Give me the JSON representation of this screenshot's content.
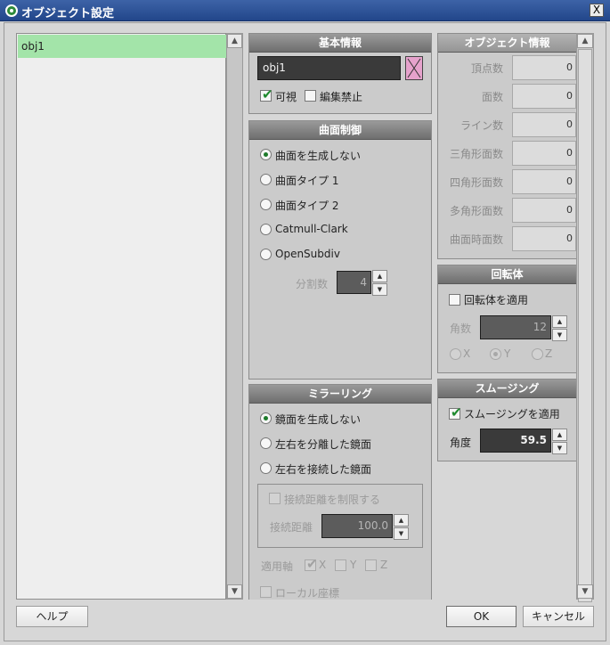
{
  "window": {
    "title": "オブジェクト設定",
    "close_glyph": "X"
  },
  "object_list": {
    "items": [
      "obj1"
    ]
  },
  "basic_info": {
    "title": "基本情報",
    "name_value": "obj1",
    "visible_label": "可視",
    "visible_checked": true,
    "lock_edit_label": "編集禁止",
    "lock_edit_checked": false
  },
  "subdivision": {
    "title": "曲面制御",
    "options": [
      "曲面を生成しない",
      "曲面タイプ 1",
      "曲面タイプ 2",
      "Catmull-Clark",
      "OpenSubdiv"
    ],
    "selected_index": 0,
    "divisions_label": "分割数",
    "divisions_value": "4"
  },
  "mirroring": {
    "title": "ミラーリング",
    "options": [
      "鏡面を生成しない",
      "左右を分離した鏡面",
      "左右を接続した鏡面"
    ],
    "selected_index": 0,
    "limit_distance_label": "接続距離を制限する",
    "distance_label": "接続距離",
    "distance_value": "100.0",
    "axis_label": "適用軸",
    "axis_x": "X",
    "axis_y": "Y",
    "axis_z": "Z",
    "local_coords_label": "ローカル座標"
  },
  "object_info": {
    "title": "オブジェクト情報",
    "rows": [
      {
        "label": "頂点数",
        "value": "0"
      },
      {
        "label": "面数",
        "value": "0"
      },
      {
        "label": "ライン数",
        "value": "0"
      },
      {
        "label": "三角形面数",
        "value": "0"
      },
      {
        "label": "四角形面数",
        "value": "0"
      },
      {
        "label": "多角形面数",
        "value": "0"
      },
      {
        "label": "曲面時面数",
        "value": "0"
      }
    ]
  },
  "lathe": {
    "title": "回転体",
    "apply_label": "回転体を適用",
    "angle_label": "角数",
    "angle_value": "12",
    "axis_x": "X",
    "axis_y": "Y",
    "axis_z": "Z"
  },
  "smoothing": {
    "title": "スムージング",
    "apply_label": "スムージングを適用",
    "apply_checked": true,
    "angle_label": "角度",
    "angle_value": "59.5"
  },
  "buttons": {
    "help": "ヘルプ",
    "ok": "OK",
    "cancel": "キャンセル"
  },
  "icons": {
    "check": "✔",
    "up": "▲",
    "down": "▼"
  },
  "colors": {
    "title_bar": "#2c52a0",
    "selection": "#a3e4a9",
    "check": "#1e8a2e"
  }
}
